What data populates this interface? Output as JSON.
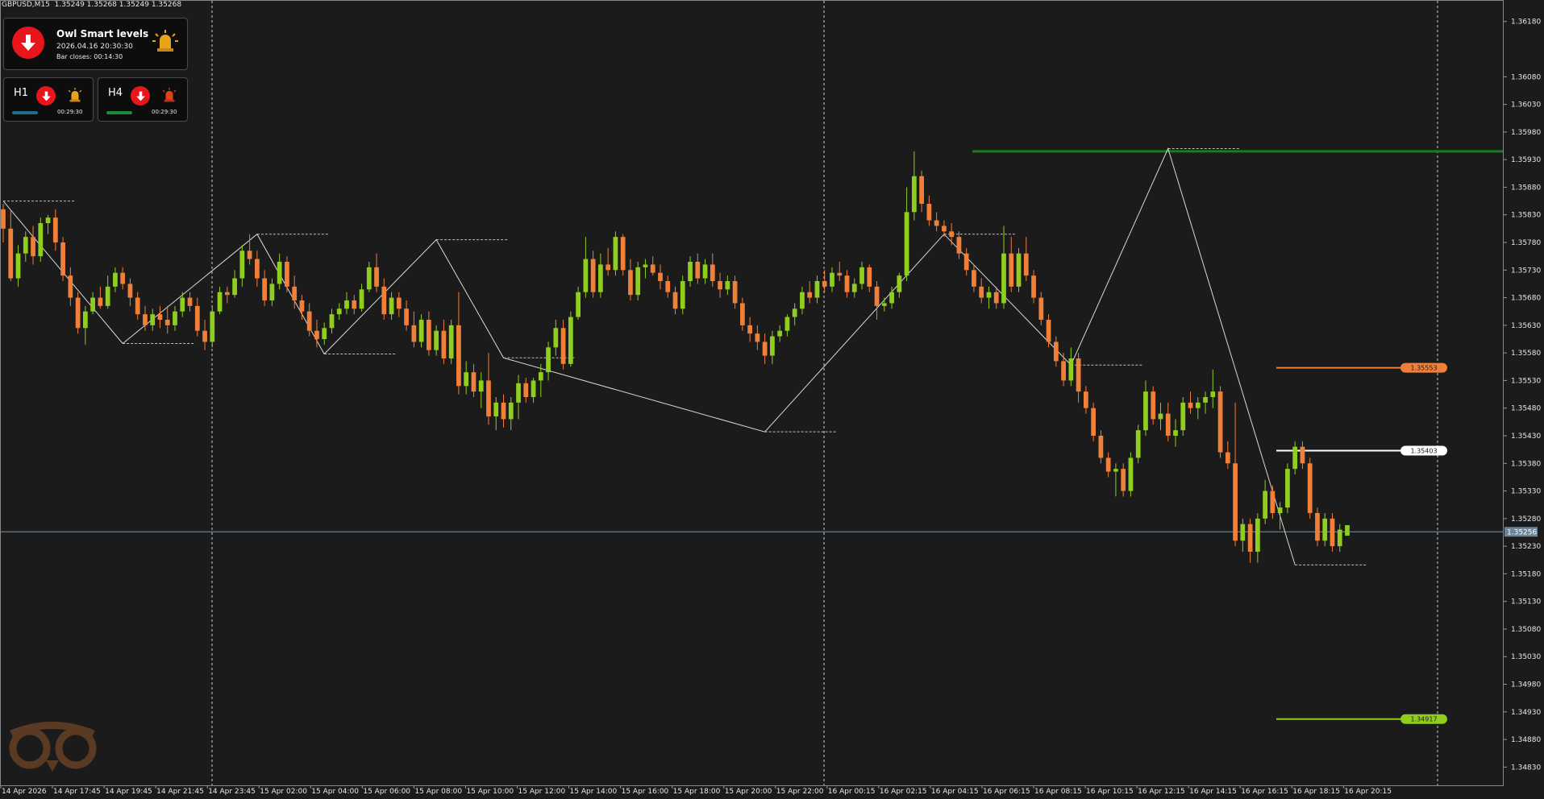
{
  "symbol_bar": "GBPUSD,M15  1.35249 1.35268 1.35249 1.35268",
  "panel_main": {
    "title": "Owl Smart levels",
    "date": "2026.04.16 20:30:30",
    "bar_closes": "Bar closes: 00:14:30",
    "signal": "down",
    "alarm_icon": "alarm-siren-icon"
  },
  "panel_h1": {
    "label": "H1",
    "time": "00:29:30",
    "signal": "down",
    "bar_color": "#1f6f8b"
  },
  "panel_h4": {
    "label": "H4",
    "time": "00:29:30",
    "signal": "down",
    "bar_color": "#1f8b3a"
  },
  "colors": {
    "background": "#1b1b1b",
    "bull": "#8fce1e",
    "bear": "#f07f3a",
    "zigzag": "#d8d8d8",
    "resistance": "#1e7a1e",
    "sell_level": "#f07f3a",
    "mid_level": "#ffffff",
    "buy_level": "#8fce1e"
  },
  "chart_data": {
    "type": "candlestick",
    "title": "GBPUSD,M15",
    "y_axis_ticks": [
      "1.36180",
      "1.36080",
      "1.36030",
      "1.35980",
      "1.35930",
      "1.35880",
      "1.35830",
      "1.35780",
      "1.35730",
      "1.35680",
      "1.35630",
      "1.35580",
      "1.35530",
      "1.35480",
      "1.35430",
      "1.35380",
      "1.35330",
      "1.35280",
      "1.35230",
      "1.35180",
      "1.35130",
      "1.35080",
      "1.35030",
      "1.34980",
      "1.34930",
      "1.34880",
      "1.34830"
    ],
    "ylim": [
      1.34797,
      1.36219
    ],
    "x_axis_ticks": [
      "14 Apr 2026",
      "14 Apr 17:45",
      "14 Apr 19:45",
      "14 Apr 21:45",
      "14 Apr 23:45",
      "15 Apr 02:00",
      "15 Apr 04:00",
      "15 Apr 06:00",
      "15 Apr 08:00",
      "15 Apr 10:00",
      "15 Apr 12:00",
      "15 Apr 14:00",
      "15 Apr 16:00",
      "15 Apr 18:00",
      "15 Apr 20:00",
      "15 Apr 22:00",
      "16 Apr 00:15",
      "16 Apr 02:15",
      "16 Apr 04:15",
      "16 Apr 06:15",
      "16 Apr 08:15",
      "16 Apr 10:15",
      "16 Apr 12:15",
      "16 Apr 14:15",
      "16 Apr 16:15",
      "16 Apr 18:15",
      "16 Apr 20:15"
    ],
    "current_price": "1.35256",
    "levels": [
      {
        "name": "sell-level",
        "price": 1.35553,
        "label": "1.35553"
      },
      {
        "name": "mid-level",
        "price": 1.35403,
        "label": "1.35403"
      },
      {
        "name": "buy-level",
        "price": 1.34917,
        "label": "1.34917"
      },
      {
        "name": "resistance-level",
        "price": 1.35945
      }
    ],
    "zigzag": [
      1.35855,
      1.35597,
      1.35795,
      1.35578,
      1.35785,
      1.35571,
      1.35437,
      1.35795,
      1.35558,
      1.3595,
      1.35196
    ],
    "candles_ohlc": [
      [
        1.3584,
        1.3585,
        1.3578,
        1.35805
      ],
      [
        1.35805,
        1.3584,
        1.3571,
        1.35715
      ],
      [
        1.35715,
        1.35775,
        1.357,
        1.3576
      ],
      [
        1.3576,
        1.358,
        1.35745,
        1.3579
      ],
      [
        1.3579,
        1.3581,
        1.3574,
        1.35755
      ],
      [
        1.35755,
        1.35825,
        1.35745,
        1.35815
      ],
      [
        1.35815,
        1.3583,
        1.35795,
        1.35825
      ],
      [
        1.35825,
        1.3584,
        1.35765,
        1.3578
      ],
      [
        1.3578,
        1.3579,
        1.3571,
        1.3572
      ],
      [
        1.3572,
        1.35735,
        1.35665,
        1.3568
      ],
      [
        1.3568,
        1.3569,
        1.35615,
        1.35625
      ],
      [
        1.35625,
        1.35665,
        1.35595,
        1.35655
      ],
      [
        1.35655,
        1.3569,
        1.3565,
        1.3568
      ],
      [
        1.3568,
        1.357,
        1.3566,
        1.35665
      ],
      [
        1.35665,
        1.3572,
        1.3566,
        1.357
      ],
      [
        1.357,
        1.35735,
        1.3569,
        1.35725
      ],
      [
        1.35725,
        1.35735,
        1.35695,
        1.35705
      ],
      [
        1.35705,
        1.35715,
        1.35665,
        1.3568
      ],
      [
        1.3568,
        1.3569,
        1.3564,
        1.3565
      ],
      [
        1.3565,
        1.35665,
        1.3562,
        1.3563
      ],
      [
        1.3563,
        1.3566,
        1.3562,
        1.3565
      ],
      [
        1.3565,
        1.35665,
        1.35625,
        1.3564
      ],
      [
        1.3564,
        1.35665,
        1.35615,
        1.3563
      ],
      [
        1.3563,
        1.35665,
        1.3562,
        1.35655
      ],
      [
        1.35655,
        1.3569,
        1.35645,
        1.3568
      ],
      [
        1.3568,
        1.3569,
        1.35655,
        1.35665
      ],
      [
        1.35665,
        1.3568,
        1.3561,
        1.3562
      ],
      [
        1.3562,
        1.3564,
        1.35585,
        1.356
      ],
      [
        1.356,
        1.35665,
        1.3559,
        1.35655
      ],
      [
        1.35655,
        1.357,
        1.3565,
        1.3569
      ],
      [
        1.3569,
        1.357,
        1.3567,
        1.35685
      ],
      [
        1.35685,
        1.3573,
        1.3568,
        1.35715
      ],
      [
        1.35715,
        1.35775,
        1.357,
        1.35765
      ],
      [
        1.35765,
        1.35795,
        1.3574,
        1.3575
      ],
      [
        1.3575,
        1.35765,
        1.357,
        1.35715
      ],
      [
        1.35715,
        1.3573,
        1.35665,
        1.35675
      ],
      [
        1.35675,
        1.35715,
        1.35665,
        1.35705
      ],
      [
        1.35705,
        1.3576,
        1.35695,
        1.35745
      ],
      [
        1.35745,
        1.35755,
        1.3569,
        1.357
      ],
      [
        1.357,
        1.3572,
        1.3566,
        1.35675
      ],
      [
        1.35675,
        1.35685,
        1.3564,
        1.35655
      ],
      [
        1.35655,
        1.3567,
        1.3561,
        1.3562
      ],
      [
        1.3562,
        1.3564,
        1.3559,
        1.35605
      ],
      [
        1.35605,
        1.35635,
        1.35595,
        1.35625
      ],
      [
        1.35625,
        1.3566,
        1.35615,
        1.3565
      ],
      [
        1.3565,
        1.3567,
        1.3564,
        1.3566
      ],
      [
        1.3566,
        1.3569,
        1.3565,
        1.35675
      ],
      [
        1.35675,
        1.35685,
        1.3565,
        1.3566
      ],
      [
        1.3566,
        1.35705,
        1.35655,
        1.35695
      ],
      [
        1.35695,
        1.35745,
        1.3569,
        1.35735
      ],
      [
        1.35735,
        1.3576,
        1.3569,
        1.357
      ],
      [
        1.357,
        1.35715,
        1.3564,
        1.3565
      ],
      [
        1.3565,
        1.3569,
        1.3564,
        1.3568
      ],
      [
        1.3568,
        1.3569,
        1.35645,
        1.3566
      ],
      [
        1.3566,
        1.35675,
        1.3562,
        1.3563
      ],
      [
        1.3563,
        1.35655,
        1.3559,
        1.356
      ],
      [
        1.356,
        1.3565,
        1.3559,
        1.3564
      ],
      [
        1.3564,
        1.35655,
        1.35575,
        1.35585
      ],
      [
        1.35585,
        1.3563,
        1.35575,
        1.3562
      ],
      [
        1.3562,
        1.3564,
        1.3556,
        1.3557
      ],
      [
        1.3557,
        1.3564,
        1.3556,
        1.3563
      ],
      [
        1.3563,
        1.3569,
        1.35505,
        1.3552
      ],
      [
        1.3552,
        1.35565,
        1.35505,
        1.35545
      ],
      [
        1.35545,
        1.3556,
        1.355,
        1.3551
      ],
      [
        1.3551,
        1.35545,
        1.3548,
        1.3553
      ],
      [
        1.3553,
        1.3558,
        1.3545,
        1.35465
      ],
      [
        1.35465,
        1.355,
        1.3544,
        1.3549
      ],
      [
        1.3549,
        1.35505,
        1.35445,
        1.3546
      ],
      [
        1.3546,
        1.355,
        1.3544,
        1.3549
      ],
      [
        1.3549,
        1.3554,
        1.3546,
        1.35525
      ],
      [
        1.35525,
        1.35535,
        1.3549,
        1.355
      ],
      [
        1.355,
        1.35535,
        1.3549,
        1.3553
      ],
      [
        1.3553,
        1.3556,
        1.355,
        1.35545
      ],
      [
        1.35545,
        1.356,
        1.3553,
        1.3559
      ],
      [
        1.3559,
        1.3564,
        1.35575,
        1.35625
      ],
      [
        1.35625,
        1.3564,
        1.3555,
        1.3556
      ],
      [
        1.3556,
        1.35655,
        1.35555,
        1.35645
      ],
      [
        1.35645,
        1.357,
        1.3564,
        1.3569
      ],
      [
        1.3569,
        1.3579,
        1.3568,
        1.3575
      ],
      [
        1.3575,
        1.35765,
        1.3568,
        1.3569
      ],
      [
        1.3569,
        1.3576,
        1.3568,
        1.3574
      ],
      [
        1.3574,
        1.3577,
        1.3572,
        1.3573
      ],
      [
        1.3573,
        1.358,
        1.3572,
        1.3579
      ],
      [
        1.3579,
        1.35795,
        1.3572,
        1.3573
      ],
      [
        1.3573,
        1.3575,
        1.35675,
        1.35685
      ],
      [
        1.35685,
        1.35745,
        1.35675,
        1.35735
      ],
      [
        1.35735,
        1.3575,
        1.35715,
        1.3574
      ],
      [
        1.3574,
        1.35755,
        1.3572,
        1.35725
      ],
      [
        1.35725,
        1.3574,
        1.35695,
        1.3571
      ],
      [
        1.3571,
        1.3572,
        1.3568,
        1.3569
      ],
      [
        1.3569,
        1.357,
        1.3565,
        1.3566
      ],
      [
        1.3566,
        1.3572,
        1.3565,
        1.3571
      ],
      [
        1.3571,
        1.35755,
        1.357,
        1.35745
      ],
      [
        1.35745,
        1.3576,
        1.35705,
        1.35715
      ],
      [
        1.35715,
        1.3575,
        1.35705,
        1.3574
      ],
      [
        1.3574,
        1.3576,
        1.357,
        1.3571
      ],
      [
        1.3571,
        1.35725,
        1.3568,
        1.35695
      ],
      [
        1.35695,
        1.3572,
        1.35685,
        1.3571
      ],
      [
        1.3571,
        1.3572,
        1.3566,
        1.3567
      ],
      [
        1.3567,
        1.3568,
        1.3562,
        1.3563
      ],
      [
        1.3563,
        1.35645,
        1.356,
        1.35615
      ],
      [
        1.35615,
        1.3563,
        1.35585,
        1.356
      ],
      [
        1.356,
        1.35615,
        1.3556,
        1.35575
      ],
      [
        1.35575,
        1.3562,
        1.3556,
        1.3561
      ],
      [
        1.3561,
        1.3563,
        1.356,
        1.3562
      ],
      [
        1.3562,
        1.3565,
        1.3561,
        1.35645
      ],
      [
        1.35645,
        1.3567,
        1.3563,
        1.3566
      ],
      [
        1.3566,
        1.357,
        1.3565,
        1.3569
      ],
      [
        1.3569,
        1.3571,
        1.3567,
        1.3568
      ],
      [
        1.3568,
        1.3572,
        1.3567,
        1.3571
      ],
      [
        1.3571,
        1.3573,
        1.3569,
        1.357
      ],
      [
        1.357,
        1.35735,
        1.3569,
        1.35725
      ],
      [
        1.35725,
        1.35745,
        1.3571,
        1.3572
      ],
      [
        1.3572,
        1.3573,
        1.3568,
        1.3569
      ],
      [
        1.3569,
        1.35715,
        1.3568,
        1.35705
      ],
      [
        1.35705,
        1.35745,
        1.35695,
        1.35735
      ],
      [
        1.35735,
        1.3574,
        1.3569,
        1.357
      ],
      [
        1.357,
        1.3571,
        1.3564,
        1.35665
      ],
      [
        1.35665,
        1.3568,
        1.35655,
        1.3567
      ],
      [
        1.3567,
        1.357,
        1.3566,
        1.3569
      ],
      [
        1.3569,
        1.35725,
        1.3568,
        1.3572
      ],
      [
        1.3572,
        1.3588,
        1.3571,
        1.35835
      ],
      [
        1.35835,
        1.35945,
        1.3582,
        1.359
      ],
      [
        1.359,
        1.3591,
        1.35835,
        1.3585
      ],
      [
        1.3585,
        1.35865,
        1.3581,
        1.3582
      ],
      [
        1.3582,
        1.35835,
        1.358,
        1.3581
      ],
      [
        1.3581,
        1.3582,
        1.3579,
        1.358
      ],
      [
        1.358,
        1.35815,
        1.35775,
        1.3579
      ],
      [
        1.3579,
        1.358,
        1.3575,
        1.3576
      ],
      [
        1.3576,
        1.3577,
        1.3572,
        1.3573
      ],
      [
        1.3573,
        1.3574,
        1.3569,
        1.357
      ],
      [
        1.357,
        1.35715,
        1.3567,
        1.3568
      ],
      [
        1.3568,
        1.357,
        1.3566,
        1.3569
      ],
      [
        1.3569,
        1.357,
        1.3566,
        1.3567
      ],
      [
        1.3567,
        1.3581,
        1.3566,
        1.3576
      ],
      [
        1.3576,
        1.3579,
        1.3569,
        1.357
      ],
      [
        1.357,
        1.3577,
        1.3569,
        1.3576
      ],
      [
        1.3576,
        1.3579,
        1.3571,
        1.3572
      ],
      [
        1.3572,
        1.3573,
        1.3567,
        1.3568
      ],
      [
        1.3568,
        1.3569,
        1.3563,
        1.3564
      ],
      [
        1.3564,
        1.3565,
        1.3559,
        1.356
      ],
      [
        1.356,
        1.3561,
        1.35555,
        1.35565
      ],
      [
        1.35565,
        1.3558,
        1.3552,
        1.3553
      ],
      [
        1.3553,
        1.3559,
        1.3552,
        1.3557
      ],
      [
        1.3557,
        1.3558,
        1.3549,
        1.3551
      ],
      [
        1.3551,
        1.3552,
        1.3547,
        1.3548
      ],
      [
        1.3548,
        1.3549,
        1.3542,
        1.3543
      ],
      [
        1.3543,
        1.3544,
        1.3538,
        1.3539
      ],
      [
        1.3539,
        1.354,
        1.35355,
        1.35365
      ],
      [
        1.35365,
        1.3538,
        1.3532,
        1.3537
      ],
      [
        1.3537,
        1.3538,
        1.3532,
        1.3533
      ],
      [
        1.3533,
        1.354,
        1.3532,
        1.3539
      ],
      [
        1.3539,
        1.3545,
        1.3538,
        1.3544
      ],
      [
        1.3544,
        1.3553,
        1.3543,
        1.3551
      ],
      [
        1.3551,
        1.3552,
        1.3545,
        1.3546
      ],
      [
        1.3546,
        1.3549,
        1.3544,
        1.3547
      ],
      [
        1.3547,
        1.3549,
        1.3542,
        1.3543
      ],
      [
        1.3543,
        1.3546,
        1.3541,
        1.3544
      ],
      [
        1.3544,
        1.355,
        1.3543,
        1.3549
      ],
      [
        1.3549,
        1.3551,
        1.3547,
        1.3548
      ],
      [
        1.3548,
        1.355,
        1.3546,
        1.3549
      ],
      [
        1.3549,
        1.3551,
        1.3547,
        1.355
      ],
      [
        1.355,
        1.3555,
        1.3548,
        1.3551
      ],
      [
        1.3551,
        1.3552,
        1.3539,
        1.354
      ],
      [
        1.354,
        1.3542,
        1.3537,
        1.3538
      ],
      [
        1.3538,
        1.3549,
        1.3523,
        1.3524
      ],
      [
        1.3524,
        1.3528,
        1.3522,
        1.3527
      ],
      [
        1.3527,
        1.3528,
        1.352,
        1.3522
      ],
      [
        1.3522,
        1.3529,
        1.352,
        1.3528
      ],
      [
        1.3528,
        1.3535,
        1.3527,
        1.3533
      ],
      [
        1.3533,
        1.3534,
        1.3528,
        1.3529
      ],
      [
        1.3529,
        1.3531,
        1.3526,
        1.353
      ],
      [
        1.353,
        1.3538,
        1.3529,
        1.3537
      ],
      [
        1.3537,
        1.3542,
        1.3536,
        1.3541
      ],
      [
        1.3541,
        1.3542,
        1.3537,
        1.3538
      ],
      [
        1.3538,
        1.3539,
        1.3528,
        1.3529
      ],
      [
        1.3529,
        1.353,
        1.3523,
        1.3524
      ],
      [
        1.3524,
        1.3529,
        1.3523,
        1.3528
      ],
      [
        1.3528,
        1.3529,
        1.3522,
        1.3523
      ],
      [
        1.3523,
        1.3527,
        1.3522,
        1.3526
      ],
      [
        1.35249,
        1.35268,
        1.35249,
        1.35268
      ]
    ],
    "grid": false,
    "legend": "none"
  }
}
